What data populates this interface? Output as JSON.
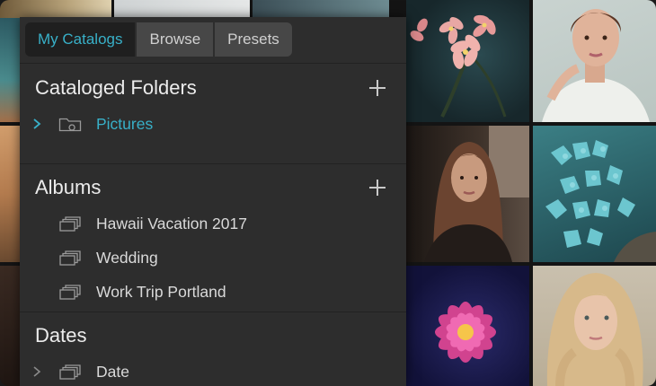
{
  "tabs": [
    {
      "label": "My Catalogs",
      "active": true
    },
    {
      "label": "Browse",
      "active": false
    },
    {
      "label": "Presets",
      "active": false
    }
  ],
  "sections": {
    "cataloged_folders": {
      "title": "Cataloged Folders",
      "items": [
        {
          "label": "Pictures",
          "icon": "folder-icon",
          "expander": "chevron-right-icon"
        }
      ]
    },
    "albums": {
      "title": "Albums",
      "items": [
        {
          "label": "Hawaii Vacation 2017",
          "icon": "album-stack-icon"
        },
        {
          "label": "Wedding",
          "icon": "album-stack-icon"
        },
        {
          "label": "Work Trip Portland",
          "icon": "album-stack-icon"
        }
      ]
    },
    "dates": {
      "title": "Dates",
      "items": [
        {
          "label": "Date",
          "icon": "album-stack-icon",
          "expander": "chevron-right-icon"
        }
      ]
    }
  },
  "colors": {
    "accent": "#38b0c8",
    "panel_bg": "#2d2d2d",
    "tab_bg": "#474747",
    "tab_active_bg": "#1f1f1f"
  },
  "background_photos": [
    "pink-plumeria-flowers",
    "woman-white-shirt-portrait",
    "long-haired-woman-portrait",
    "blue-hydrangea",
    "pink-dahlia",
    "blonde-woman-portrait"
  ]
}
